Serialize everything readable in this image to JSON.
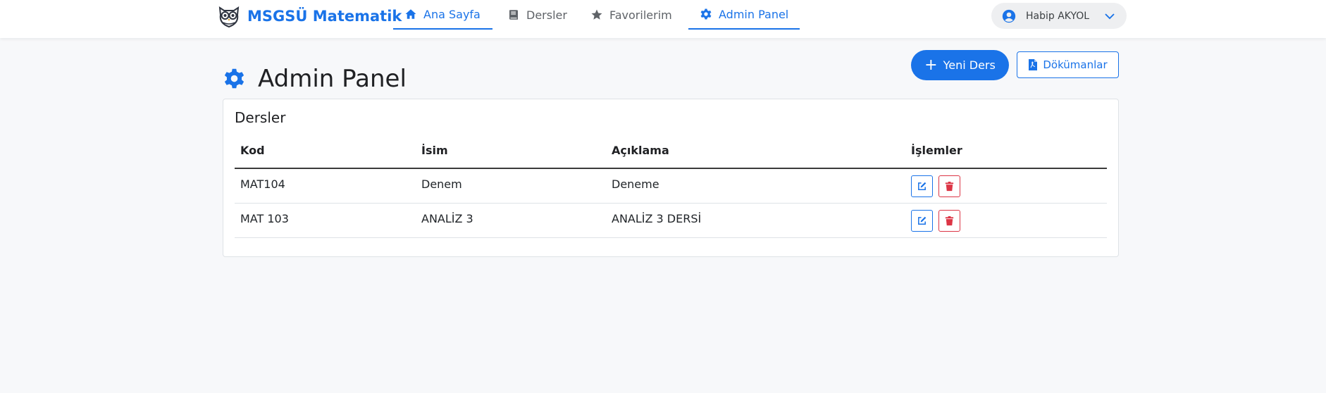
{
  "navbar": {
    "brand": "MSGSÜ Matematik",
    "items": [
      {
        "label": "Ana Sayfa",
        "icon": "home-icon",
        "active": true
      },
      {
        "label": "Dersler",
        "icon": "book-icon",
        "active": false
      },
      {
        "label": "Favorilerim",
        "icon": "star-icon",
        "active": false
      },
      {
        "label": "Admin Panel",
        "icon": "gear-icon",
        "active": true
      }
    ],
    "user": {
      "name": "Habip AKYOL",
      "icon": "user-circle-icon",
      "menu_icon": "chevron-down-icon"
    }
  },
  "page": {
    "title": "Admin Panel",
    "title_icon": "gear-icon",
    "new_course_label": "Yeni Ders",
    "documents_label": "Dökümanlar"
  },
  "card": {
    "title": "Dersler",
    "columns": [
      "Kod",
      "İsim",
      "Açıklama",
      "İşlemler"
    ],
    "rows": [
      {
        "code": "MAT104",
        "name": "Denem",
        "description": "Deneme"
      },
      {
        "code": "MAT 103",
        "name": "ANALİZ 3",
        "description": "ANALİZ 3 DERSİ"
      }
    ]
  },
  "colors": {
    "primary": "#1a73e8",
    "danger": "#dc3545",
    "background": "#f7f8fa"
  }
}
